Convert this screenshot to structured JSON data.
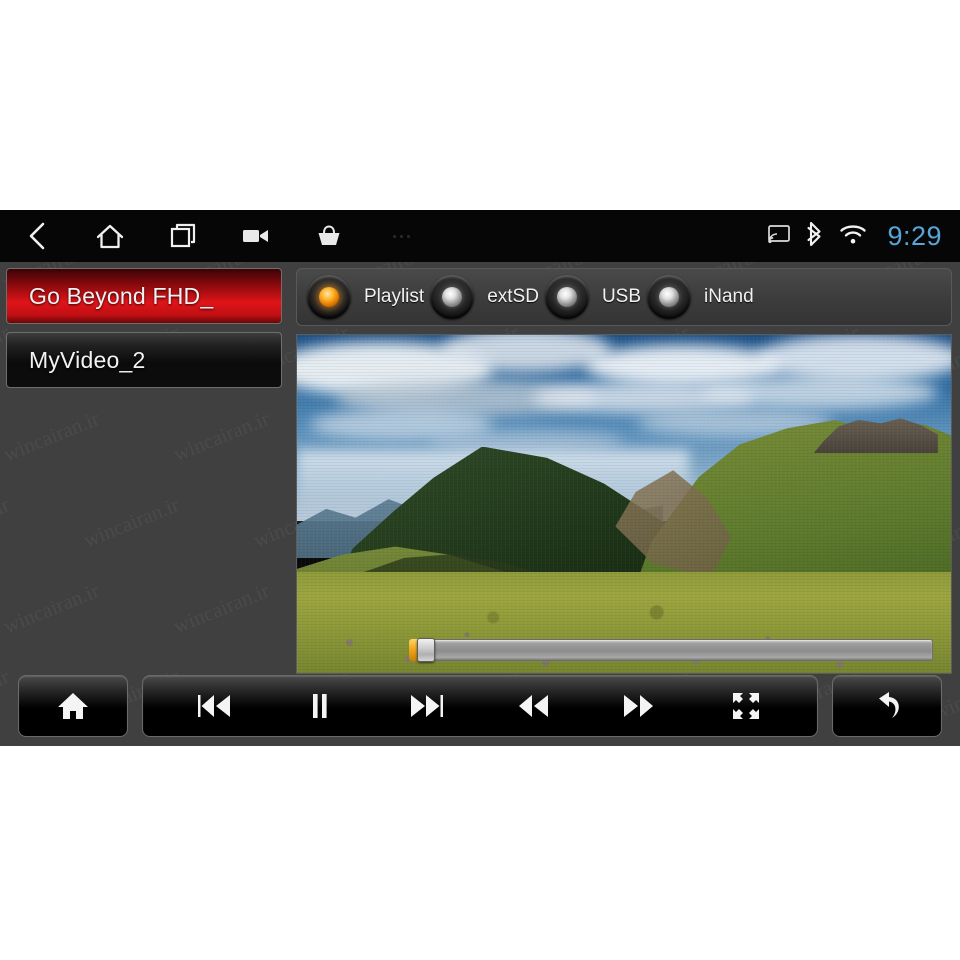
{
  "app": {
    "title": "Android Car Head Unit - Video Player",
    "screen_bg": "#404040",
    "accent_red": "#e01419",
    "accent_amber": "#ffb22a",
    "clock_color": "#58a5d8",
    "watermark_text": "wincairan.ir"
  },
  "statusbar": {
    "clock": "9:29",
    "nav_items": [
      {
        "name": "back-icon",
        "label": "Back"
      },
      {
        "name": "home-icon",
        "label": "Home"
      },
      {
        "name": "recents-icon",
        "label": "Recent apps"
      },
      {
        "name": "video-camera-icon",
        "label": "Screen record"
      },
      {
        "name": "basket-icon",
        "label": "Apps"
      },
      {
        "name": "overflow-menu-icon",
        "label": "More"
      }
    ],
    "indicators": [
      {
        "name": "cast-icon",
        "label": "Cast"
      },
      {
        "name": "bluetooth-icon",
        "label": "Bluetooth"
      },
      {
        "name": "wifi-icon",
        "label": "Wi-Fi"
      }
    ]
  },
  "playlist": {
    "items": [
      {
        "label": "Go Beyond FHD_",
        "selected": true
      },
      {
        "label": "MyVideo_2",
        "selected": false
      }
    ]
  },
  "sources": [
    {
      "label": "Playlist",
      "selected": true
    },
    {
      "label": "extSD",
      "selected": false
    },
    {
      "label": "USB",
      "selected": false
    },
    {
      "label": "iNand",
      "selected": false
    }
  ],
  "video": {
    "scene_description": "Alpine mountain meadow with wildflowers under dramatic cloudy sky",
    "seek": {
      "progress_percent": 2,
      "thumb_position_percent": 2
    }
  },
  "controls": {
    "home": {
      "label": "Home",
      "icon": "home-icon"
    },
    "main": [
      {
        "label": "Previous",
        "icon": "previous-track-icon"
      },
      {
        "label": "Pause",
        "icon": "pause-icon"
      },
      {
        "label": "Next",
        "icon": "next-track-icon"
      },
      {
        "label": "Rewind",
        "icon": "rewind-icon"
      },
      {
        "label": "Fast forward",
        "icon": "fast-forward-icon"
      },
      {
        "label": "Fullscreen",
        "icon": "fullscreen-icon"
      }
    ],
    "back": {
      "label": "Return",
      "icon": "return-arrow-icon"
    }
  }
}
